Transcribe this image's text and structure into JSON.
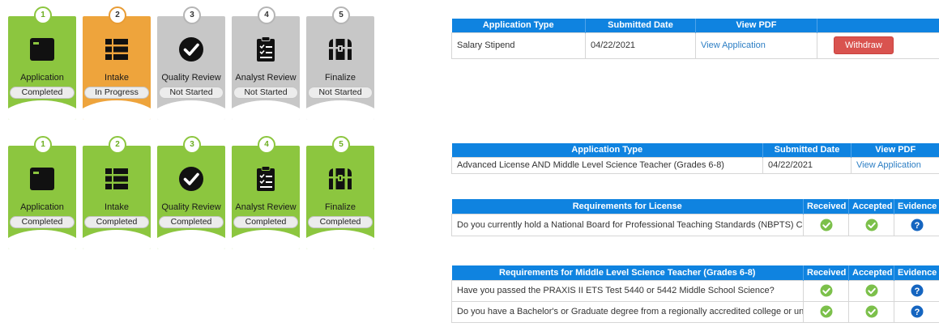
{
  "tracker1": {
    "steps": [
      {
        "num": "1",
        "title": "Application",
        "status": "Completed",
        "icon": "application-window-icon"
      },
      {
        "num": "2",
        "title": "Intake",
        "status": "In Progress",
        "icon": "list-icon"
      },
      {
        "num": "3",
        "title": "Quality Review",
        "status": "Not Started",
        "icon": "check-circle-icon"
      },
      {
        "num": "4",
        "title": "Analyst Review",
        "status": "Not Started",
        "icon": "clipboard-list-icon"
      },
      {
        "num": "5",
        "title": "Finalize",
        "status": "Not Started",
        "icon": "treasure-chest-icon"
      }
    ]
  },
  "tracker2": {
    "steps": [
      {
        "num": "1",
        "title": "Application",
        "status": "Completed",
        "icon": "application-window-icon"
      },
      {
        "num": "2",
        "title": "Intake",
        "status": "Completed",
        "icon": "list-icon"
      },
      {
        "num": "3",
        "title": "Quality Review",
        "status": "Completed",
        "icon": "check-circle-icon"
      },
      {
        "num": "4",
        "title": "Analyst Review",
        "status": "Completed",
        "icon": "clipboard-list-icon"
      },
      {
        "num": "5",
        "title": "Finalize",
        "status": "Completed",
        "icon": "treasure-chest-icon"
      }
    ]
  },
  "colors": {
    "green": "#8cc63f",
    "orange": "#eea43c",
    "gray": "#c7c7c7",
    "header_blue": "#0f83e0",
    "withdraw_red": "#d9534f"
  },
  "app_table1": {
    "headers": [
      "Application Type",
      "Submitted Date",
      "View PDF"
    ],
    "row": {
      "type": "Salary Stipend",
      "date": "04/22/2021",
      "link": "View Application",
      "button": "Withdraw"
    }
  },
  "app_table2": {
    "headers": [
      "Application Type",
      "Submitted Date",
      "View PDF"
    ],
    "row": {
      "type": "Advanced License AND Middle Level Science Teacher (Grades 6-8)",
      "date": "04/22/2021",
      "link": "View Application"
    }
  },
  "req_license": {
    "headers": [
      "Requirements for License",
      "Received",
      "Accepted",
      "Evidence"
    ],
    "rows": [
      {
        "question": "Do you currently hold a National Board for Professional Teaching Standards (NBPTS) Certification?"
      }
    ]
  },
  "req_science": {
    "headers": [
      "Requirements for Middle Level Science Teacher (Grades 6-8)",
      "Received",
      "Accepted",
      "Evidence"
    ],
    "rows": [
      {
        "question": "Have you passed the PRAXIS II ETS Test 5440 or 5442 Middle School Science?"
      },
      {
        "question": "Do you have a Bachelor's or Graduate degree from a regionally accredited college or university?"
      }
    ]
  }
}
